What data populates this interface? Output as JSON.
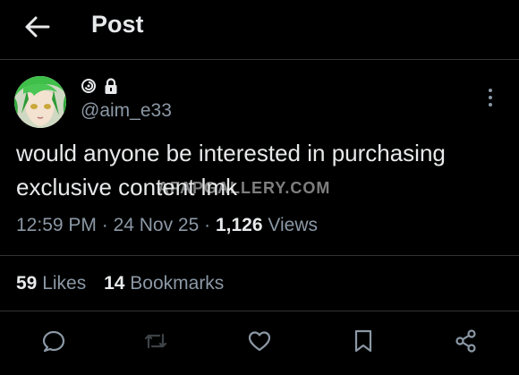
{
  "header": {
    "title": "Post"
  },
  "author": {
    "handle": "@aim_e33"
  },
  "post": {
    "text": "would anyone be interested in purchasing exclusive content lmk",
    "watermark": "AFAPGALLERY.COM",
    "time": "12:59 PM",
    "date": "24 Nov 25",
    "views_count": "1,126",
    "views_label": "Views"
  },
  "stats": {
    "likes_count": "59",
    "likes_label": "Likes",
    "bookmarks_count": "14",
    "bookmarks_label": "Bookmarks"
  },
  "colors": {
    "background": "#000000",
    "text": "#e7e9ea",
    "muted": "#8b98a5",
    "divider": "#2f3336"
  },
  "icons": [
    "back-arrow-icon",
    "swirl-icon",
    "lock-icon",
    "more-icon",
    "reply-icon",
    "repost-icon",
    "like-icon",
    "bookmark-icon",
    "share-icon"
  ]
}
